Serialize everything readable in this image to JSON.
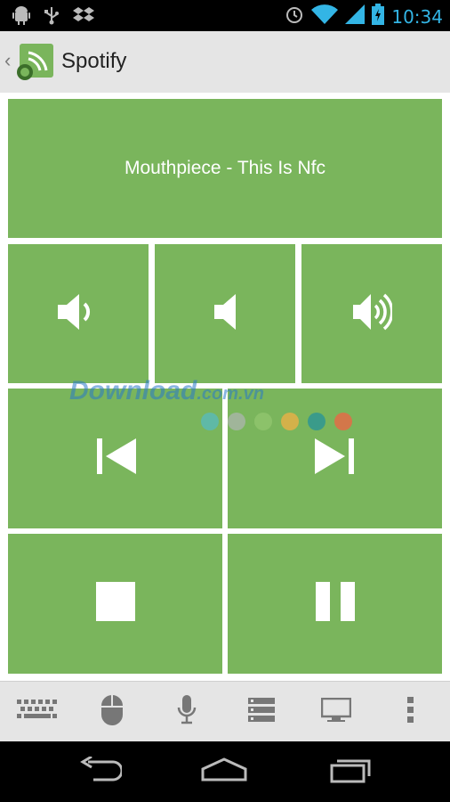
{
  "status_bar": {
    "time": "10:34",
    "left_icons": [
      "android-debug-icon",
      "usb-icon",
      "dropbox-icon"
    ],
    "right_icons": [
      "alarm-icon",
      "wifi-icon",
      "signal-icon",
      "battery-charging-icon"
    ]
  },
  "app_bar": {
    "title": "Spotify"
  },
  "now_playing": {
    "text": "Mouthpiece - This Is Nfc"
  },
  "controls": {
    "volume": [
      "volume-down-icon",
      "mute-icon",
      "volume-up-icon"
    ],
    "track": [
      "previous-track-icon",
      "next-track-icon"
    ],
    "playback": [
      "stop-icon",
      "pause-icon"
    ]
  },
  "bottom_bar": {
    "items": [
      "keyboard-icon",
      "mouse-icon",
      "microphone-icon",
      "server-list-icon",
      "monitor-icon",
      "overflow-menu-icon"
    ]
  },
  "watermark": {
    "main": "Download",
    "suffix": ".com.vn"
  },
  "watermark_dots": [
    "#5fb9a6",
    "#a0b59a",
    "#8cc26a",
    "#d4b14a",
    "#3a9b8a",
    "#d3774a"
  ],
  "colors": {
    "tile": "#7ab55c",
    "time": "#33b5e5",
    "app_bar_bg": "#e5e5e5"
  }
}
